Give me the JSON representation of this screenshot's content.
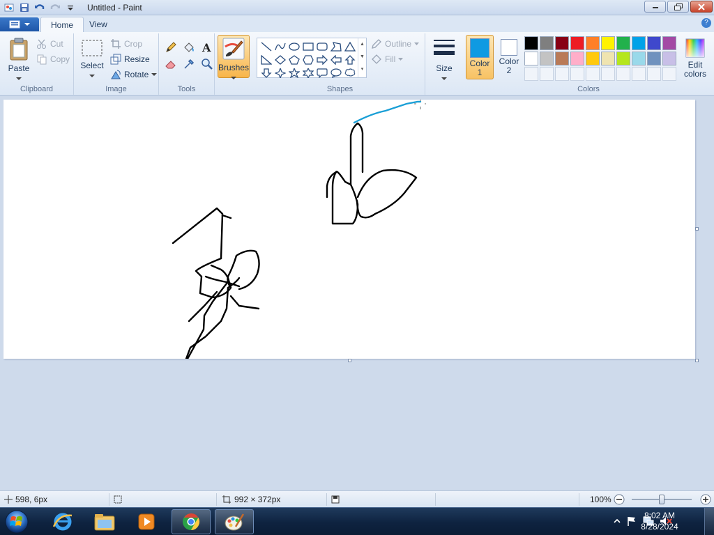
{
  "window": {
    "title": "Untitled - Paint",
    "controls": [
      "minimize",
      "maximize",
      "close"
    ]
  },
  "quick_access": [
    "save-icon",
    "undo-icon",
    "redo-icon",
    "customize-dropdown-icon"
  ],
  "tabs": [
    {
      "label": "Home",
      "active": true
    },
    {
      "label": "View",
      "active": false
    }
  ],
  "ribbon": {
    "clipboard": {
      "group": "Clipboard",
      "paste": "Paste",
      "cut": "Cut",
      "copy": "Copy"
    },
    "image": {
      "group": "Image",
      "select": "Select",
      "crop": "Crop",
      "resize": "Resize",
      "rotate": "Rotate"
    },
    "tools": {
      "group": "Tools",
      "items": [
        "pencil-icon",
        "fill-icon",
        "text-icon",
        "eraser-icon",
        "color-picker-icon",
        "magnifier-icon"
      ]
    },
    "brushes": {
      "label": "Brushes"
    },
    "shapes": {
      "group": "Shapes",
      "outline": "Outline",
      "fill": "Fill"
    },
    "size": {
      "label": "Size"
    },
    "colors": {
      "group": "Colors",
      "color1_label": "Color",
      "color1_num": "1",
      "color2_label": "Color",
      "color2_num": "2",
      "edit_colors": "Edit colors",
      "color1_value": "#0f9ae2",
      "color2_value": "#ffffff",
      "palette_row1": [
        "#000000",
        "#7f7f7f",
        "#880015",
        "#ed1c24",
        "#ff7f27",
        "#fff200",
        "#22b14c",
        "#00a2e8",
        "#3f48cc",
        "#a349a4"
      ],
      "palette_row2": [
        "#ffffff",
        "#c3c3c3",
        "#b97a57",
        "#ffaec9",
        "#ffc90e",
        "#efe4b0",
        "#b5e61d",
        "#99d9ea",
        "#7092be",
        "#c8bfe7"
      ]
    }
  },
  "canvas": {
    "background": "#ffffff",
    "stroke_colors": {
      "black": "#000000",
      "blue": "#1a9fd6"
    }
  },
  "statusbar": {
    "cursor_pos": "598, 6px",
    "image_size": "992 × 372px",
    "zoom": "100%"
  },
  "taskbar": {
    "pinned": [
      "start-orb-icon",
      "internet-explorer-icon",
      "file-explorer-icon",
      "media-player-icon",
      "chrome-icon",
      "paint-icon"
    ],
    "time": "8:02 AM",
    "date": "8/28/2024"
  }
}
